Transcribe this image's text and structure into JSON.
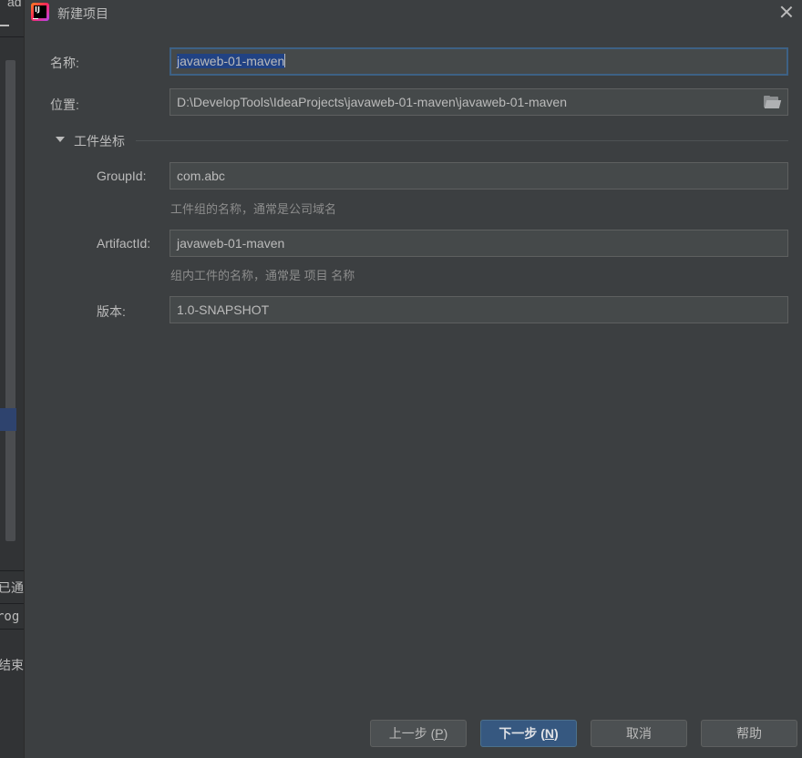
{
  "background": {
    "fragments": [
      "ad",
      "已通过",
      "rog",
      "结束"
    ]
  },
  "dialog": {
    "title": "新建项目",
    "app_icon_text": "IJ",
    "name_label": "名称:",
    "name_value": "javaweb-01-maven",
    "location_label": "位置:",
    "location_value": "D:\\DevelopTools\\IdeaProjects\\javaweb-01-maven\\javaweb-01-maven",
    "section_title": "工件坐标",
    "group_label": "GroupId:",
    "group_value": "com.abc",
    "group_hint": "工件组的名称，通常是公司域名",
    "artifact_label": "ArtifactId:",
    "artifact_value": "javaweb-01-maven",
    "artifact_hint": "组内工件的名称，通常是 项目 名称",
    "version_label": "版本:",
    "version_value": "1.0-SNAPSHOT"
  },
  "buttons": {
    "prev_text": "上一步 (",
    "prev_mnemonic": "P",
    "prev_suffix": ")",
    "next_text": "下一步 (",
    "next_mnemonic": "N",
    "next_suffix": ")",
    "cancel": "取消",
    "help": "帮助"
  },
  "colors": {
    "dialog_bg": "#3c3f41",
    "field_bg": "#45494a",
    "primary_button": "#365880",
    "selection": "#214283"
  }
}
